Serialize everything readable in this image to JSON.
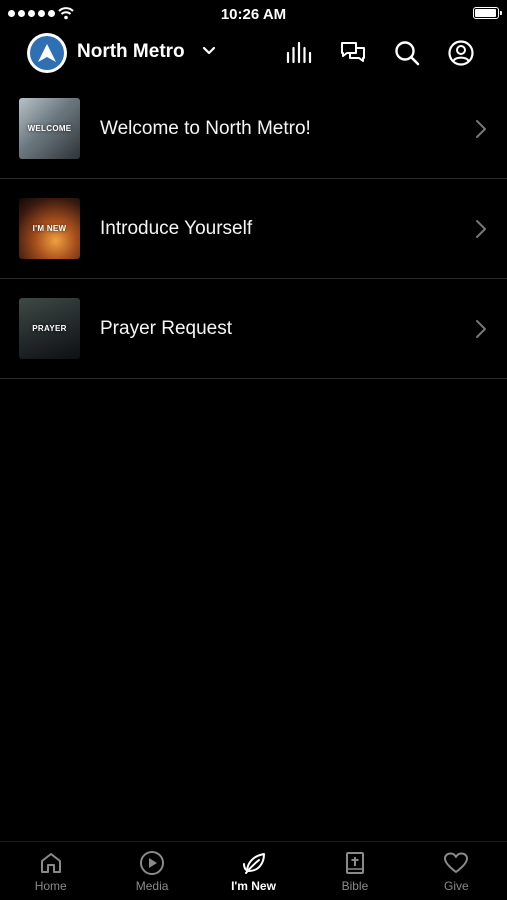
{
  "status_bar": {
    "time": "10:26 AM",
    "battery_level": 0.95
  },
  "header": {
    "org_name": "North Metro",
    "icons": [
      "audio-icon",
      "chat-icon",
      "search-icon",
      "profile-icon"
    ]
  },
  "list": {
    "items": [
      {
        "label": "Welcome to North Metro!",
        "thumb_text": "WELCOME"
      },
      {
        "label": "Introduce Yourself",
        "thumb_text": "I'M NEW"
      },
      {
        "label": "Prayer Request",
        "thumb_text": "PRAYER"
      }
    ]
  },
  "tab_bar": {
    "tabs": [
      {
        "label": "Home",
        "icon": "home-icon"
      },
      {
        "label": "Media",
        "icon": "play-icon"
      },
      {
        "label": "I'm New",
        "icon": "leaf-icon"
      },
      {
        "label": "Bible",
        "icon": "bible-icon"
      },
      {
        "label": "Give",
        "icon": "heart-icon"
      }
    ],
    "active": "I'm New"
  },
  "colors": {
    "background": "#000000",
    "text": "#ffffff",
    "inactive": "#8a8a8a",
    "logo_blue": "#2f6fb3",
    "divider": "#2a2a2a"
  }
}
